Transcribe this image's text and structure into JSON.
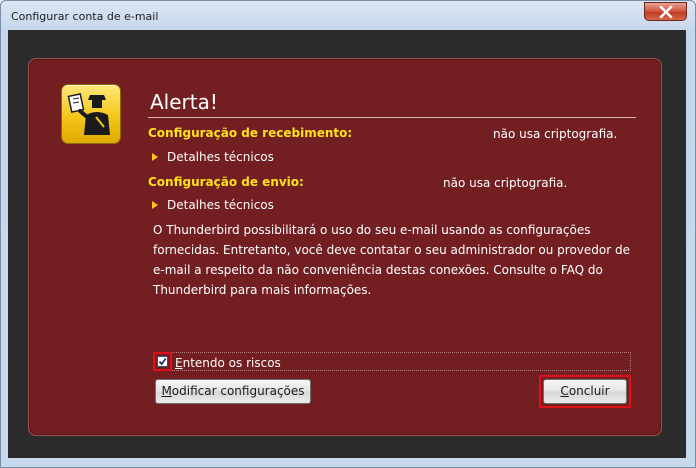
{
  "window": {
    "title": "Configurar conta de e-mail"
  },
  "alert": {
    "heading": "Alerta!",
    "incoming_label": "Configuração de recebimento:",
    "incoming_value": "não usa criptografia.",
    "incoming_details": "Detalhes técnicos",
    "outgoing_label": "Configuração de envio:",
    "outgoing_value": "não usa criptografia.",
    "outgoing_details": "Detalhes técnicos",
    "description": "O Thunderbird possibilitará o uso do seu e-mail usando as configurações fornecidas. Entretanto, você deve contatar o seu administrador ou provedor de e-mail a respeito da não conveniência destas conexões. Consulte o FAQ do Thunderbird para mais informações."
  },
  "risk": {
    "checkbox_access_key": "E",
    "checkbox_label_rest": "ntendo os riscos",
    "checked": true
  },
  "buttons": {
    "modify_access_key": "M",
    "modify_rest": "odificar configurações",
    "done_access_key": "C",
    "done_rest": "oncluir"
  },
  "colors": {
    "panel": "#731f22",
    "label": "#ffe21a",
    "highlight": "#e0101a",
    "icon": "#f4c61c"
  },
  "icons": {
    "close": "close-icon",
    "alert": "security-officer-icon",
    "disclosure": "triangle-right-icon",
    "check": "checkmark-icon"
  }
}
